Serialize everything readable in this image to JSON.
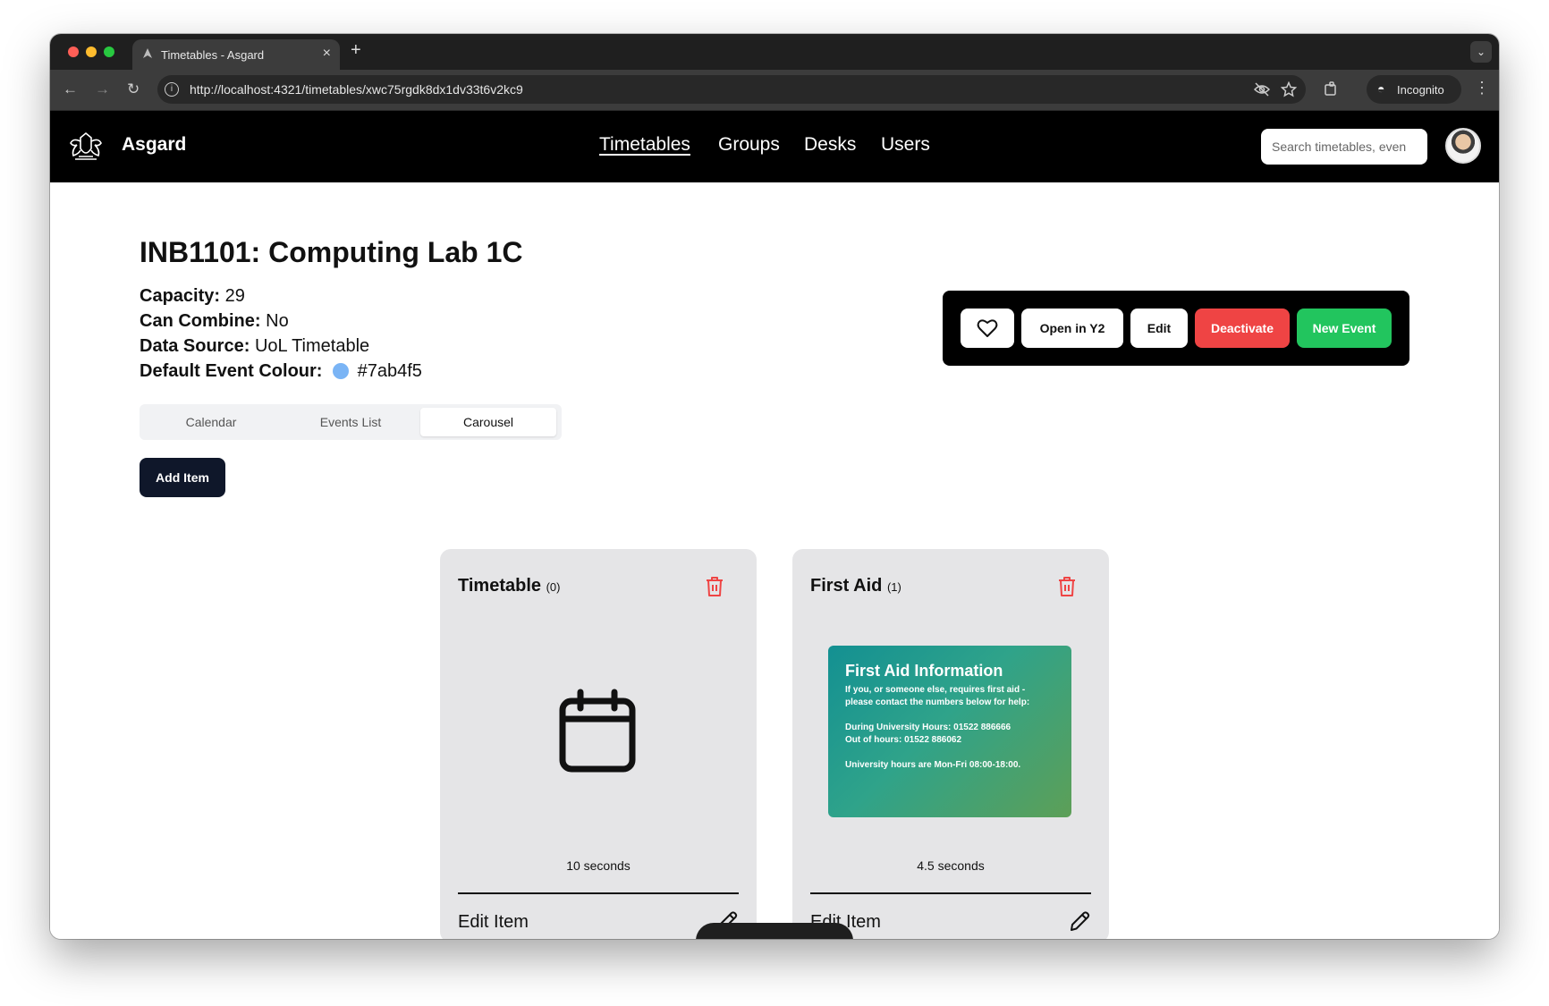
{
  "browser": {
    "tab_title": "Timetables - Asgard",
    "tab_close": "×",
    "new_tab": "+",
    "tab_menu": "⌄",
    "url": "http://localhost:4321/timetables/xwc75rgdk8dx1dv33t6v2kc9",
    "incognito_label": "Incognito",
    "back": "←",
    "forward": "→",
    "reload": "↻",
    "kebab": "⋮"
  },
  "nav": {
    "brand": "Asgard",
    "links": [
      "Timetables",
      "Groups",
      "Desks",
      "Users"
    ],
    "active": "Timetables",
    "search_placeholder": "Search timetables, even"
  },
  "room": {
    "code": "INB1101:",
    "name": "Computing Lab 1C",
    "capacity_label": "Capacity:",
    "capacity": "29",
    "combine_label": "Can Combine:",
    "combine": "No",
    "source_label": "Data Source:",
    "source": "UoL Timetable",
    "colour_label": "Default Event Colour:",
    "colour": "#7ab4f5"
  },
  "view_tabs": [
    "Calendar",
    "Events List",
    "Carousel"
  ],
  "active_view": "Carousel",
  "add_item_label": "Add Item",
  "actions": {
    "open_y2": "Open in Y2",
    "edit": "Edit",
    "deactivate": "Deactivate",
    "new_event": "New Event",
    "colors": {
      "deactivate": "#ef4444",
      "new_event": "#22c55e"
    }
  },
  "carousel": [
    {
      "title": "Timetable",
      "count": "(0)",
      "duration": "10 seconds",
      "edit_label": "Edit Item",
      "preview_icon": "calendar-icon"
    },
    {
      "title": "First Aid",
      "count": "(1)",
      "duration": "4.5 seconds",
      "edit_label": "Edit Item",
      "preview": {
        "heading": "First Aid Information",
        "line1": "If you, or someone else, requires first aid -",
        "line2": "please contact the numbers below for help:",
        "line3": "During University Hours: 01522 886666",
        "line4": "Out of hours: 01522 886062",
        "line5": "University hours are Mon-Fri 08:00-18:00."
      }
    }
  ]
}
